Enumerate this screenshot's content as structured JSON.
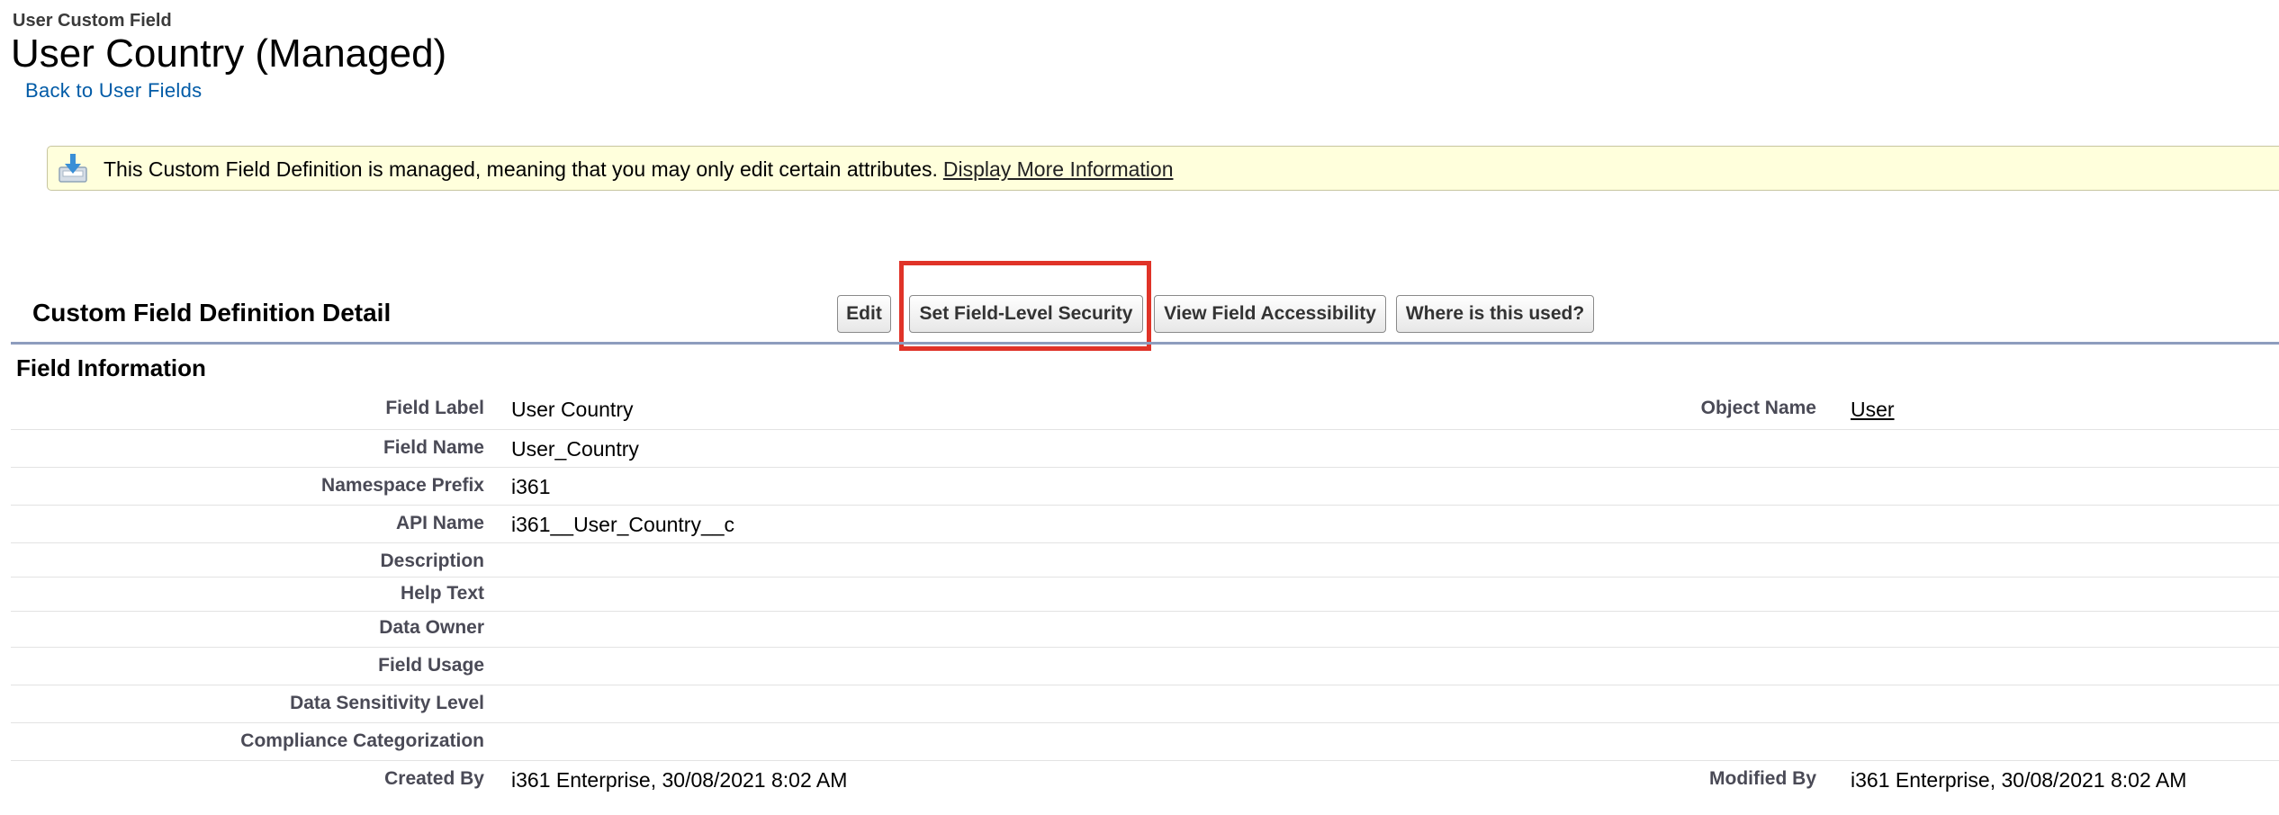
{
  "header": {
    "pre_title": "User Custom Field",
    "title": "User Country (Managed)",
    "back_link": "Back to User Fields"
  },
  "banner": {
    "text": "This Custom Field Definition is managed, meaning that you may only edit certain attributes.",
    "link": "Display More Information",
    "icon": "download-tray-icon"
  },
  "detail": {
    "section_title": "Custom Field Definition Detail",
    "buttons": {
      "edit": "Edit",
      "field_level_security": "Set Field-Level Security",
      "view_accessibility": "View Field Accessibility",
      "where_used": "Where is this used?"
    },
    "highlight_color": "#e03328",
    "subsection_title": "Field Information"
  },
  "fields": [
    {
      "label": "Field Label",
      "value": "User Country",
      "right_label": "Object Name",
      "right_value": "User"
    },
    {
      "label": "Field Name",
      "value": "User_Country"
    },
    {
      "label": "Namespace Prefix",
      "value": "i361"
    },
    {
      "label": "API Name",
      "value": "i361__User_Country__c"
    },
    {
      "label": "Description",
      "value": ""
    },
    {
      "label": "Help Text",
      "value": ""
    },
    {
      "label": "Data Owner",
      "value": ""
    },
    {
      "label": "Field Usage",
      "value": ""
    },
    {
      "label": "Data Sensitivity Level",
      "value": ""
    },
    {
      "label": "Compliance Categorization",
      "value": ""
    },
    {
      "label": "Created By",
      "value": "i361 Enterprise, 30/08/2021 8:02 AM",
      "right_label": "Modified By",
      "right_value": "i361 Enterprise, 30/08/2021 8:02 AM"
    }
  ]
}
